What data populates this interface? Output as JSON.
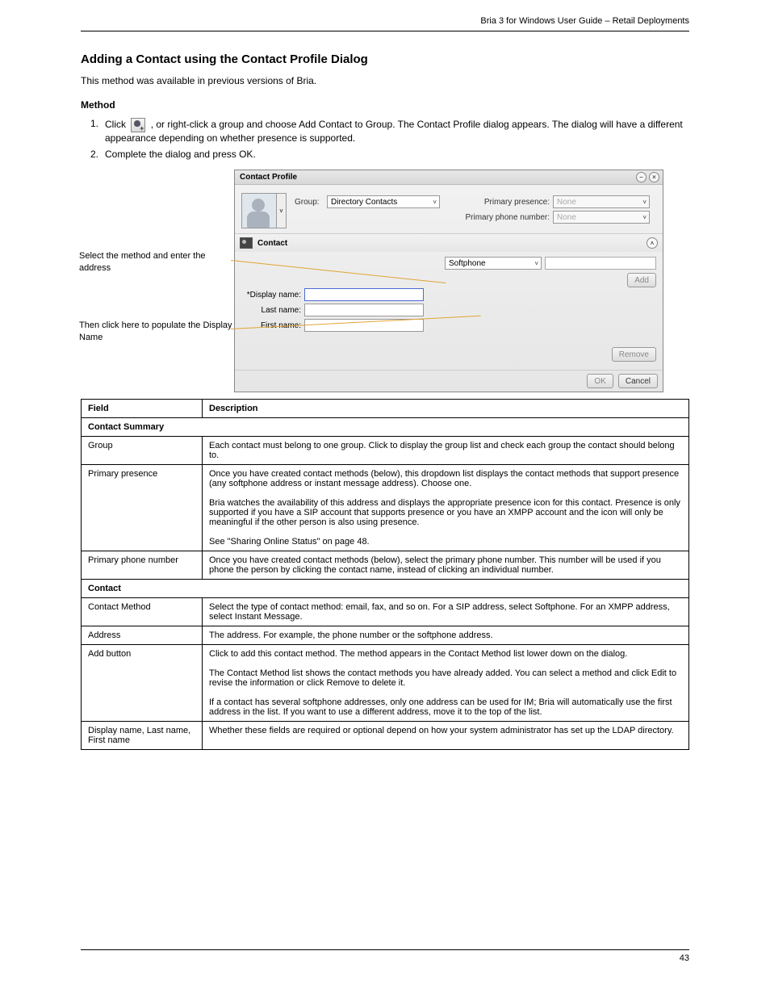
{
  "header": {
    "right": "Bria 3 for Windows User Guide – Retail Deployments"
  },
  "section_title": "Adding a Contact using the Contact Profile Dialog",
  "intro": "This method was available in previous versions of Bria.",
  "method_label": "Method",
  "step_num": "1.",
  "step_text_pre": "Click ",
  "step_text_post": ", or right-click a group and choose Add Contact to Group. The Contact Profile dialog appears. The dialog will have a different appearance depending on whether presence is supported.",
  "step2_num": "2.",
  "step2_text": "Complete the dialog and press OK.",
  "dialog": {
    "title": "Contact Profile",
    "group_label": "Group:",
    "group_value": "Directory Contacts",
    "primary_presence_label": "Primary presence:",
    "primary_presence_value": "None",
    "primary_phone_label": "Primary phone number:",
    "primary_phone_value": "None",
    "contact_header": "Contact",
    "method_value": "Softphone",
    "add_btn": "Add",
    "display_name_label": "*Display name:",
    "last_name_label": "Last name:",
    "first_name_label": "First name:",
    "remove_btn": "Remove",
    "ok_btn": "OK",
    "cancel_btn": "Cancel"
  },
  "callouts": {
    "c1": "Select the method and enter the address",
    "c2": "Then click here to populate the Display Name"
  },
  "table": {
    "h1": "Field",
    "h2": "Description",
    "s1": "Contact Summary"
  },
  "rows": [
    {
      "f": "Group",
      "d": "Each contact must belong to one group. Click to display the group list and check each group the contact should belong to."
    },
    {
      "f": "Primary presence",
      "d": "Once you have created contact methods (below), this dropdown list displays the contact methods that support presence (any softphone address or instant message address). Choose one.\n\nBria watches the availability of this address and displays the appropriate presence icon for this contact. Presence is only supported if you have a SIP account that supports presence or you have an XMPP account and the icon will only be meaningful if the other person is also using presence.\n\nSee \"Sharing Online Status\" on page 48."
    },
    {
      "f": "Primary phone number",
      "d": "Once you have created contact methods (below), select the primary phone number. This number will be used if you phone the person by clicking the contact name, instead of clicking an individual number."
    },
    {
      "s": "Contact"
    },
    {
      "f": "Contact Method",
      "d": "Select the type of contact method: email, fax, and so on. For a SIP address, select Softphone. For an XMPP address, select Instant Message."
    },
    {
      "f": "Address",
      "d": "The address. For example, the phone number or the softphone address."
    },
    {
      "f": "Add button",
      "d": "Click to add this contact method. The method appears in the Contact Method list lower down on the dialog.\n\nThe Contact Method list shows the contact methods you have already added. You can select a method and click Edit to revise the information or click Remove to delete it.\n\nIf a contact has several softphone addresses, only one address can be used for IM; Bria will automatically use the first address in the list. If you want to use a different address, move it to the top of the list."
    },
    {
      "f": "Display name, Last name, First name",
      "d": "Whether these fields are required or optional depend on how your system administrator has set up the LDAP directory."
    }
  ],
  "footer_num": "43"
}
